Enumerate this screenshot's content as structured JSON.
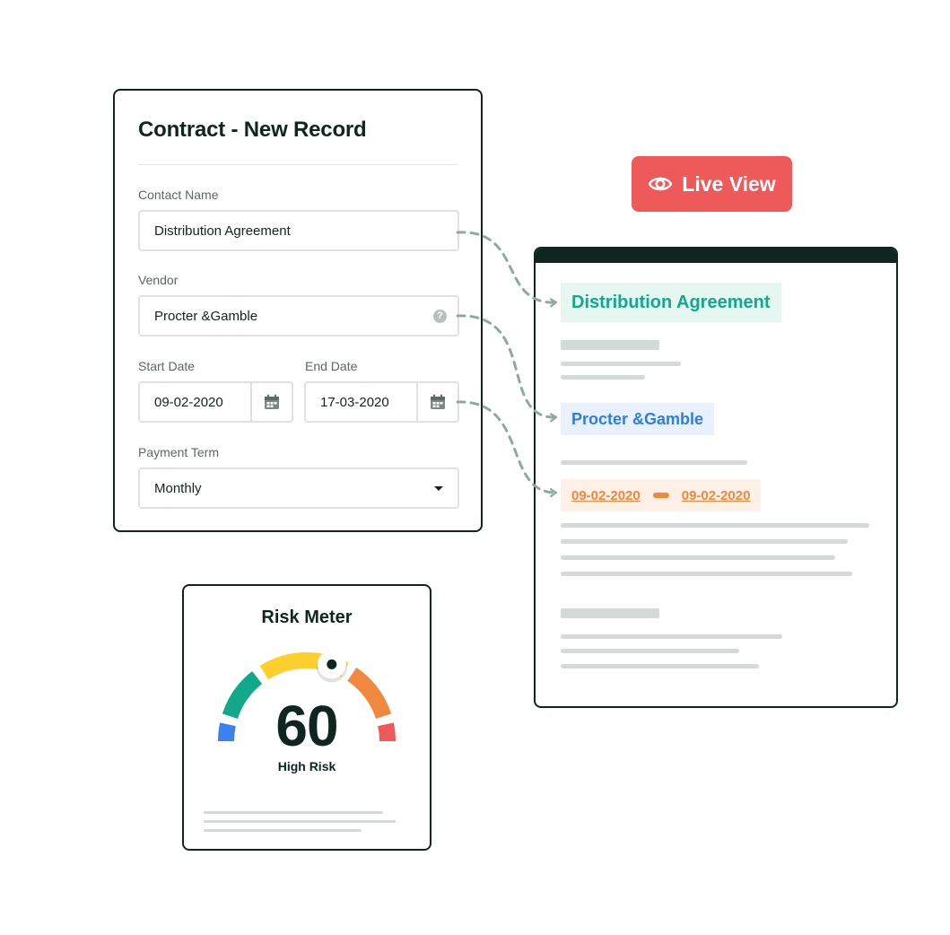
{
  "form": {
    "title": "Contract - New Record",
    "contact_name": {
      "label": "Contact Name",
      "value": "Distribution Agreement"
    },
    "vendor": {
      "label": "Vendor",
      "value": "Procter &Gamble",
      "help_icon": "question-circle-icon"
    },
    "start_date": {
      "label": "Start Date",
      "value": "09-02-2020",
      "icon": "calendar-icon"
    },
    "end_date": {
      "label": "End Date",
      "value": "17-03-2020",
      "icon": "calendar-icon"
    },
    "payment_term": {
      "label": "Payment Term",
      "value": "Monthly",
      "icon": "caret-down-icon"
    }
  },
  "live_view": {
    "label": "Live View",
    "icon": "eye-icon",
    "color": "#ee5a59"
  },
  "preview": {
    "contract_name": "Distribution Agreement",
    "vendor": "Procter &Gamble",
    "start_date": "09-02-2020",
    "end_date": "09-02-2020"
  },
  "risk_meter": {
    "title": "Risk Meter",
    "score": "60",
    "level": "High Risk",
    "score_value": 60,
    "max": 100,
    "segments": [
      {
        "color": "#3b82f0"
      },
      {
        "color": "#12a88a"
      },
      {
        "color": "#ffcf2e"
      },
      {
        "color": "#f0883e"
      },
      {
        "color": "#ee5a59"
      }
    ]
  },
  "colors": {
    "dark": "#0f2520",
    "green": "#12a88a",
    "blue": "#2e7ee0",
    "orange": "#f0883e",
    "connector": "#8fa8a0"
  }
}
